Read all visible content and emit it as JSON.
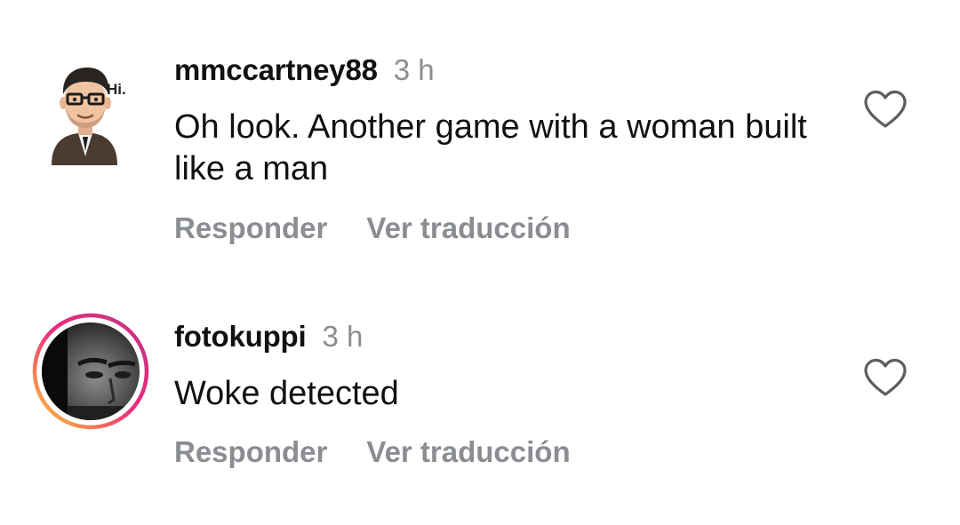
{
  "comments": [
    {
      "username": "mmccartney88",
      "time": "3 h",
      "text": "Oh look. Another game with a woman built like a man",
      "avatar_icon": "bitmoji-avatar-icon",
      "avatar_caption": "Hi.",
      "has_story_ring": false,
      "reply_label": "Responder",
      "translate_label": "Ver traducción",
      "like_icon": "heart-outline-icon"
    },
    {
      "username": "fotokuppi",
      "time": "3 h",
      "text": "Woke detected",
      "avatar_icon": "profile-photo-avatar",
      "has_story_ring": true,
      "reply_label": "Responder",
      "translate_label": "Ver traducción",
      "like_icon": "heart-outline-icon"
    }
  ],
  "colors": {
    "text_primary": "#111111",
    "text_secondary": "#8a8d91",
    "story_ring_start": "#f9ce34",
    "story_ring_mid": "#ee2a7b",
    "story_ring_end": "#6228d7"
  }
}
